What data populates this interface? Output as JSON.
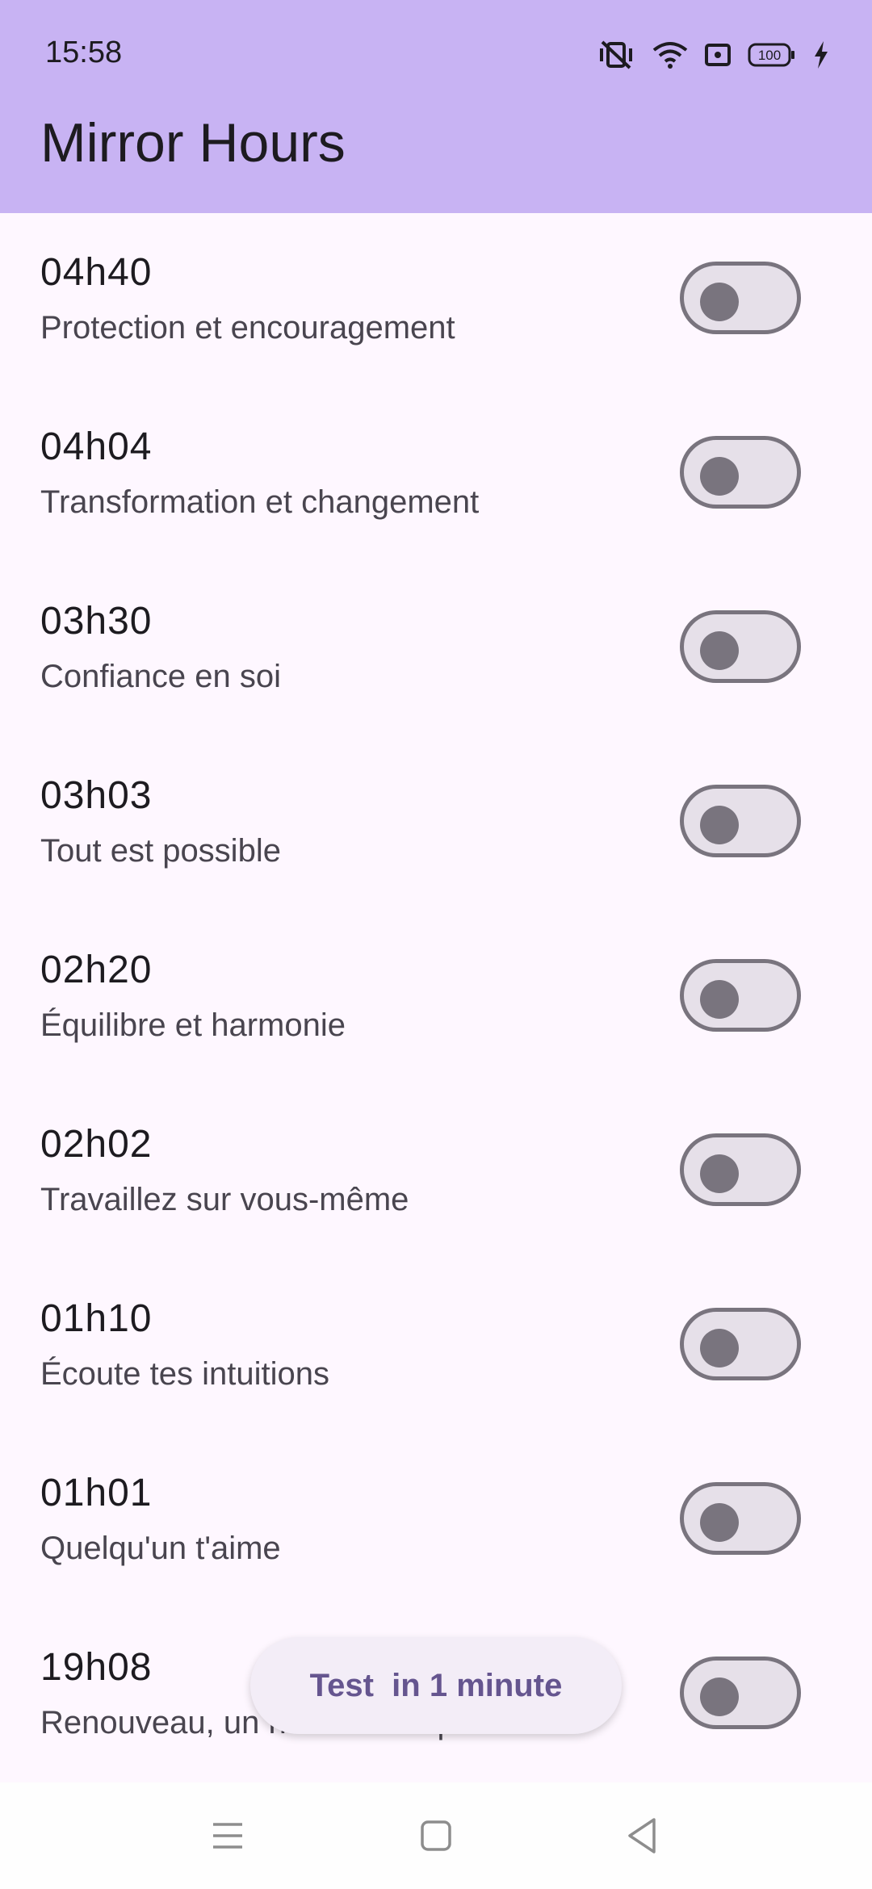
{
  "status_bar": {
    "time": "15:58",
    "battery_level": "100",
    "icons": [
      "vibrate-icon",
      "wifi-icon",
      "screen-record-icon",
      "battery-icon",
      "charging-icon"
    ]
  },
  "app_bar": {
    "title": "Mirror Hours"
  },
  "hours": [
    {
      "time": "04h40",
      "meaning": "Protection et encouragement",
      "enabled": false
    },
    {
      "time": "04h04",
      "meaning": "Transformation et changement",
      "enabled": false
    },
    {
      "time": "03h30",
      "meaning": "Confiance en soi",
      "enabled": false
    },
    {
      "time": "03h03",
      "meaning": "Tout est possible",
      "enabled": false
    },
    {
      "time": "02h20",
      "meaning": "Équilibre et harmonie",
      "enabled": false
    },
    {
      "time": "02h02",
      "meaning": "Travaillez sur vous-même",
      "enabled": false
    },
    {
      "time": "01h10",
      "meaning": "Écoute tes intuitions",
      "enabled": false
    },
    {
      "time": "01h01",
      "meaning": "Quelqu'un t'aime",
      "enabled": false
    },
    {
      "time": "19h08",
      "meaning": "Renouveau, un nouveau départ",
      "enabled": false
    }
  ],
  "toast": {
    "text": "Test  in 1 minute"
  },
  "nav_bar": {
    "icons": [
      "menu-icon",
      "home-icon",
      "back-icon"
    ]
  },
  "colors": {
    "app_bar": "#c8b3f3",
    "background": "#fef7ff",
    "switch_outline": "#79747e",
    "switch_track": "#e6e0e9",
    "toast_text": "#65558f"
  }
}
